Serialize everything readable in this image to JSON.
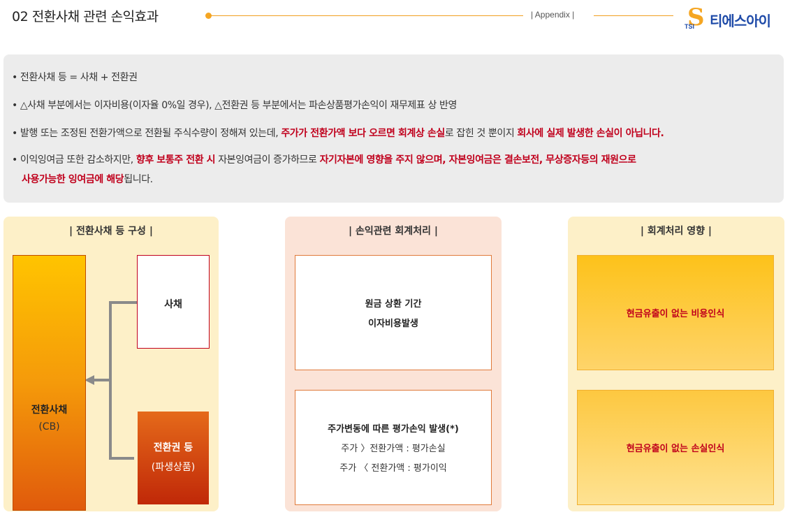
{
  "header": {
    "title": "02 전환사채 관련 손익효과",
    "section_tag": "| Appendix |",
    "logo_mark": "S",
    "logo_tsi": "TSI",
    "logo_text": "티에스아이"
  },
  "summary": {
    "bullets": [
      {
        "parts": [
          {
            "text": "• 전환사채 등 = 사채 + 전환권",
            "em": false
          }
        ]
      },
      {
        "parts": [
          {
            "text": "• △사채 부분에서는 이자비용(이자율 0%일 경우), △전환권 등 부분에서는 파손상품평가손익이 재무제표 상 반영",
            "em": false
          }
        ]
      },
      {
        "parts": [
          {
            "text": "• 발행 또는 조정된 전환가액으로 전환될 주식수량이 정해져 있는데, ",
            "em": false
          },
          {
            "text": "주가가 전환가액 보다 오르면 회계상 손실",
            "em": true
          },
          {
            "text": "로 잡힌 것 뿐이지 ",
            "em": false
          },
          {
            "text": "회사에 실제 발생한 손실이 아닙니다.",
            "em": true
          }
        ]
      },
      {
        "parts": [
          {
            "text": "• 이익잉여금 또한 감소하지만, ",
            "em": false
          },
          {
            "text": "향후 보통주 전환 시",
            "em": true
          },
          {
            "text": " 자본잉여금이 증가하므로 ",
            "em": false
          },
          {
            "text": "자기자본에 영향을 주지 않으며, 자본잉여금은 결손보전, 무상증자등의 재원으로",
            "em": true
          },
          {
            "text": "\n  ",
            "em": false
          },
          {
            "text": "사용가능한 잉여금에 해당",
            "em": true
          },
          {
            "text": "됩니다.",
            "em": false
          }
        ]
      }
    ]
  },
  "panel_composition": {
    "title": "| 전환사채 등 구성 |",
    "cb_label": "전환사채",
    "cb_sub": "(CB)",
    "bond_label": "사채",
    "conversion_label": "전환권 등",
    "conversion_sub": "(파생상품)"
  },
  "panel_accounting": {
    "title": "| 손익관련 회계처리 |",
    "box1_line1": "원금 상환 기간",
    "box1_line2": "이자비용발생",
    "box2_line1": "주가변동에 따른 평가손익 발생(*)",
    "box2_line2": "주가 〉전환가액 : 평가손실",
    "box2_line3": "주가 〈 전환가액 : 평가이익"
  },
  "panel_impact": {
    "title": "| 회계처리 영향 |",
    "box1_label": "현금유출이 없는 비용인식",
    "box2_label": "현금유출이 없는 손실인식"
  },
  "colors": {
    "accent_orange": "#f5a623",
    "emphasis_red": "#c0001c",
    "logo_blue": "#1e4aa8"
  }
}
